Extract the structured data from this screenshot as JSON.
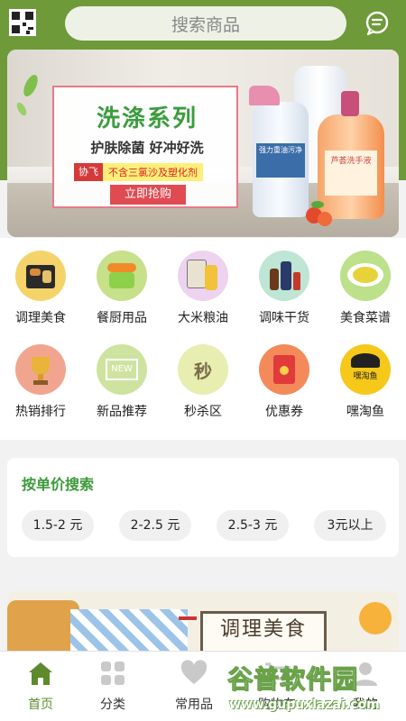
{
  "header": {
    "search_placeholder": "搜索商品",
    "qr_icon": "qrcode-icon",
    "message_icon": "chat-bubble-icon",
    "color": "#6e9a3a"
  },
  "banner": {
    "title": "洗涤系列",
    "subtitle": "护肤除菌  好冲好洗",
    "brand": "协飞",
    "claim": "不含三氯沙及塑化剂",
    "cta": "立即抢购",
    "bottle1_label": "强力重油污净",
    "bottle2_label": "芦荟洗手液"
  },
  "categories": [
    {
      "label": "调理美食",
      "icon": "prepared-food-icon"
    },
    {
      "label": "餐厨用品",
      "icon": "food-container-icon"
    },
    {
      "label": "大米粮油",
      "icon": "rice-oil-icon"
    },
    {
      "label": "调味干货",
      "icon": "seasoning-icon"
    },
    {
      "label": "美食菜谱",
      "icon": "recipe-dish-icon"
    },
    {
      "label": "热销排行",
      "icon": "trophy-icon"
    },
    {
      "label": "新品推荐",
      "icon": "new-sign-icon"
    },
    {
      "label": "秒杀区",
      "icon": "flash-sale-icon"
    },
    {
      "label": "优惠券",
      "icon": "red-envelope-icon"
    },
    {
      "label": "嘿淘鱼",
      "icon": "heitaoyu-logo-icon",
      "logo_text": "嘿淘鱼"
    }
  ],
  "price_search": {
    "title": "按单价搜索",
    "options": [
      "1.5-2 元",
      "2-2.5 元",
      "2.5-3 元",
      "3元以上"
    ]
  },
  "banner2": {
    "text": "调理美食"
  },
  "tabs": [
    {
      "label": "首页",
      "icon": "home-icon",
      "active": true
    },
    {
      "label": "分类",
      "icon": "grid-icon",
      "active": false
    },
    {
      "label": "常用品",
      "icon": "heart-icon",
      "active": false
    },
    {
      "label": "购物车",
      "icon": "cart-icon",
      "active": false
    },
    {
      "label": "我的",
      "icon": "user-icon",
      "active": false
    }
  ],
  "watermark": {
    "cn": "谷普软件园",
    "url": "www.gupuxlazai.com"
  }
}
